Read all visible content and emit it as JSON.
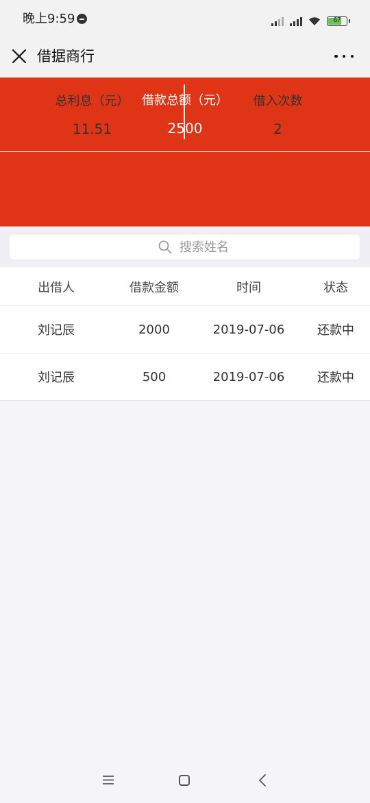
{
  "status_bar": {
    "time": "晚上9:59",
    "battery": "67"
  },
  "nav": {
    "title": "借据商行"
  },
  "summary": {
    "total_label": "借款总额（元）",
    "total_value": "2500",
    "interest_label": "总利息（元）",
    "interest_value": "11.51",
    "count_label": "借入次数",
    "count_value": "2"
  },
  "search": {
    "placeholder": "搜索姓名"
  },
  "table": {
    "headers": [
      "出借人",
      "借款金额",
      "时间",
      "状态"
    ],
    "rows": [
      [
        "刘记辰",
        "2000",
        "2019-07-06",
        "还款中"
      ],
      [
        "刘记辰",
        "500",
        "2019-07-06",
        "还款中"
      ]
    ]
  },
  "colors": {
    "accent": "#e03417",
    "background": "#f5f5f9"
  }
}
